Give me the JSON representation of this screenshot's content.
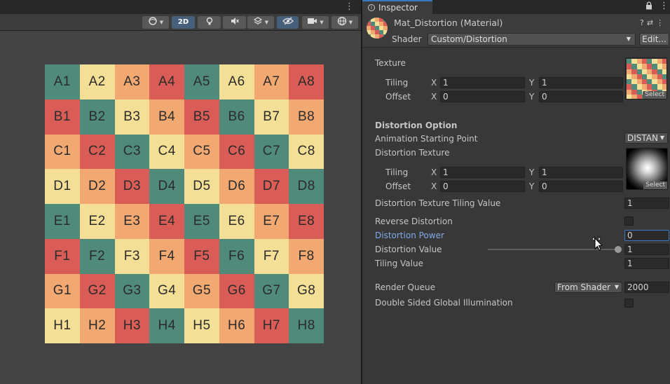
{
  "scene": {
    "menu_dots": "⋮",
    "toolbar": {
      "mode_2d": "2D"
    },
    "grid_colors": {
      "teal": "#4f8a7b",
      "yellow": "#f4df96",
      "orange": "#f1a871",
      "red": "#d95c56"
    },
    "grid": [
      [
        [
          "A1",
          "teal"
        ],
        [
          "A2",
          "yellow"
        ],
        [
          "A3",
          "orange"
        ],
        [
          "A4",
          "red"
        ],
        [
          "A5",
          "teal"
        ],
        [
          "A6",
          "yellow"
        ],
        [
          "A7",
          "orange"
        ],
        [
          "A8",
          "red"
        ]
      ],
      [
        [
          "B1",
          "red"
        ],
        [
          "B2",
          "teal"
        ],
        [
          "B3",
          "yellow"
        ],
        [
          "B4",
          "orange"
        ],
        [
          "B5",
          "red"
        ],
        [
          "B6",
          "teal"
        ],
        [
          "B7",
          "yellow"
        ],
        [
          "B8",
          "orange"
        ]
      ],
      [
        [
          "C1",
          "orange"
        ],
        [
          "C2",
          "red"
        ],
        [
          "C3",
          "teal"
        ],
        [
          "C4",
          "yellow"
        ],
        [
          "C5",
          "orange"
        ],
        [
          "C6",
          "red"
        ],
        [
          "C7",
          "teal"
        ],
        [
          "C8",
          "yellow"
        ]
      ],
      [
        [
          "D1",
          "yellow"
        ],
        [
          "D2",
          "orange"
        ],
        [
          "D3",
          "red"
        ],
        [
          "D4",
          "teal"
        ],
        [
          "D5",
          "yellow"
        ],
        [
          "D6",
          "orange"
        ],
        [
          "D7",
          "red"
        ],
        [
          "D8",
          "teal"
        ]
      ],
      [
        [
          "E1",
          "teal"
        ],
        [
          "E2",
          "yellow"
        ],
        [
          "E3",
          "orange"
        ],
        [
          "E4",
          "red"
        ],
        [
          "E5",
          "teal"
        ],
        [
          "E6",
          "yellow"
        ],
        [
          "E7",
          "orange"
        ],
        [
          "E8",
          "red"
        ]
      ],
      [
        [
          "F1",
          "red"
        ],
        [
          "F2",
          "teal"
        ],
        [
          "F3",
          "yellow"
        ],
        [
          "F4",
          "orange"
        ],
        [
          "F5",
          "red"
        ],
        [
          "F6",
          "teal"
        ],
        [
          "F7",
          "yellow"
        ],
        [
          "F8",
          "orange"
        ]
      ],
      [
        [
          "G1",
          "orange"
        ],
        [
          "G2",
          "red"
        ],
        [
          "G3",
          "teal"
        ],
        [
          "G4",
          "yellow"
        ],
        [
          "G5",
          "orange"
        ],
        [
          "G6",
          "red"
        ],
        [
          "G7",
          "teal"
        ],
        [
          "G8",
          "yellow"
        ]
      ],
      [
        [
          "H1",
          "yellow"
        ],
        [
          "H2",
          "orange"
        ],
        [
          "H3",
          "red"
        ],
        [
          "H4",
          "teal"
        ],
        [
          "H5",
          "yellow"
        ],
        [
          "H6",
          "orange"
        ],
        [
          "H7",
          "red"
        ],
        [
          "H8",
          "teal"
        ]
      ]
    ]
  },
  "inspector": {
    "tab_label": "Inspector",
    "material_name": "Mat_Distortion (Material)",
    "shader_label": "Shader",
    "shader_value": "Custom/Distortion",
    "edit_button": "Edit...",
    "texture": {
      "label": "Texture",
      "tiling_label": "Tiling",
      "offset_label": "Offset",
      "tiling_x": "1",
      "tiling_y": "1",
      "offset_x": "0",
      "offset_y": "0",
      "select_label": "Select"
    },
    "axis": {
      "x": "X",
      "y": "Y"
    },
    "distortion": {
      "section_title": "Distortion Option",
      "anim_start_label": "Animation Starting Point",
      "anim_start_value": "DISTAN",
      "tex_label": "Distortion Texture",
      "tiling_label": "Tiling",
      "offset_label": "Offset",
      "tiling_x": "1",
      "tiling_y": "1",
      "offset_x": "0",
      "offset_y": "0",
      "select_label": "Select",
      "tex_tiling_value_label": "Distortion Texture Tiling Value",
      "tex_tiling_value": "1",
      "reverse_label": "Reverse Distortion",
      "power_label": "Distortion Power",
      "power_value": "0",
      "value_label": "Distortion Value",
      "value_value": "1",
      "value_slider_fraction": 1.0,
      "tiling_value_label": "Tiling Value",
      "tiling_value": "1"
    },
    "render_queue_label": "Render Queue",
    "render_queue_mode": "From Shader",
    "render_queue_value": "2000",
    "double_sided_label": "Double Sided Global Illumination"
  }
}
